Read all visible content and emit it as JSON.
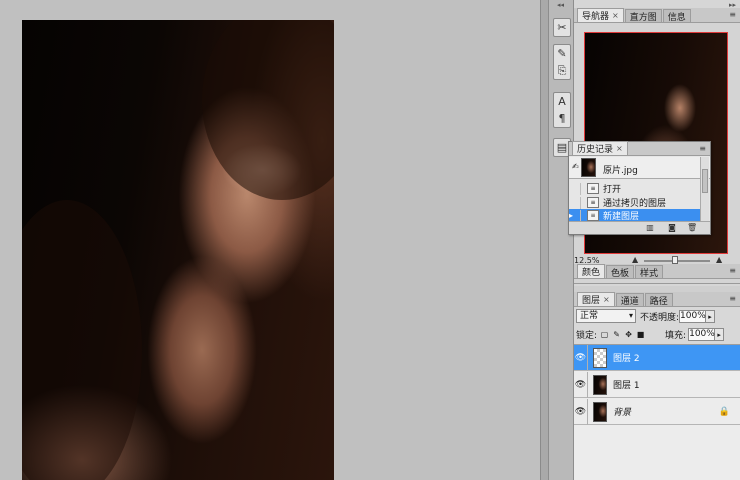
{
  "navigator": {
    "tabs": [
      {
        "label": "导航器",
        "closable": true,
        "active": true
      },
      {
        "label": "直方图",
        "closable": false,
        "active": false
      },
      {
        "label": "信息",
        "closable": false,
        "active": false
      }
    ],
    "zoom": "12.5%"
  },
  "history": {
    "tab_label": "历史记录",
    "snapshot_label": "原片.jpg",
    "steps": [
      {
        "label": "打开",
        "selected": false
      },
      {
        "label": "通过拷贝的图层",
        "selected": false
      },
      {
        "label": "新建图层",
        "selected": true
      }
    ],
    "footer_icons": [
      "new-document-from-state-icon",
      "create-snapshot-icon",
      "delete-state-icon"
    ]
  },
  "color": {
    "tabs": [
      {
        "label": "颜色",
        "active": true
      },
      {
        "label": "色板",
        "active": false
      },
      {
        "label": "样式",
        "active": false
      }
    ]
  },
  "layers": {
    "tabs": [
      {
        "label": "图层",
        "active": true,
        "closable": true
      },
      {
        "label": "通道",
        "active": false,
        "closable": false
      },
      {
        "label": "路径",
        "active": false,
        "closable": false
      }
    ],
    "blend_mode": "正常",
    "opacity_label": "不透明度:",
    "opacity_value": "100%",
    "lock_label": "锁定:",
    "fill_label": "填充:",
    "fill_value": "100%",
    "items": [
      {
        "name": "图层 2",
        "selected": true,
        "visible": true,
        "thumb": "transparent"
      },
      {
        "name": "图层 1",
        "selected": false,
        "visible": true,
        "thumb": "photo"
      },
      {
        "name": "背景",
        "selected": false,
        "visible": true,
        "thumb": "photo",
        "locked": true
      }
    ]
  },
  "colors": {
    "selection": "#3e96f4",
    "navigator_box": "#e03a3a"
  }
}
